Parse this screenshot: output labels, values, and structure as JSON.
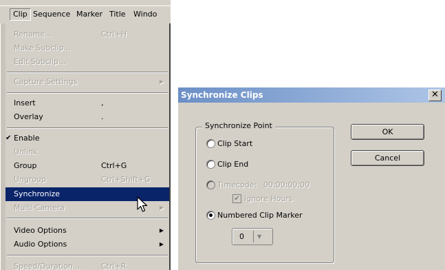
{
  "menubar": {
    "items": [
      "Clip",
      "Sequence",
      "Marker",
      "Title",
      "Windo"
    ]
  },
  "clip_menu": {
    "items": [
      {
        "label": "Rename...",
        "shortcut": "Ctrl+H"
      },
      {
        "label": "Make Subclip..."
      },
      {
        "label": "Edit Subclip..."
      },
      {
        "label": "Capture Settings",
        "arrow": "▶"
      },
      {
        "label": "Insert",
        "shortcut": ","
      },
      {
        "label": "Overlay",
        "shortcut": "."
      },
      {
        "label": "Enable",
        "check": "✔"
      },
      {
        "label": "Unlink"
      },
      {
        "label": "Group",
        "shortcut": "Ctrl+G"
      },
      {
        "label": "Ungroup",
        "shortcut": "Ctrl+Shift+G"
      },
      {
        "label": "Synchronize"
      },
      {
        "label": "Multi-Camera",
        "arrow": "▶"
      },
      {
        "label": "Video Options",
        "arrow": "▶"
      },
      {
        "label": "Audio Options",
        "arrow": "▶"
      },
      {
        "label": "Speed/Duration...",
        "shortcut": "Ctrl+R"
      }
    ]
  },
  "dialog": {
    "title": "Synchronize Clips",
    "close_label": "✕",
    "group_title": "Synchronize Point",
    "options": {
      "clip_start": "Clip Start",
      "clip_end": "Clip End",
      "timecode": "Timecode:",
      "timecode_value": "00;00;00;00",
      "ignore_hours": "Ignore Hours",
      "numbered_marker": "Numbered Clip Marker"
    },
    "marker_value": "0",
    "marker_arrow": "▼",
    "ok_label": "OK",
    "cancel_label": "Cancel"
  },
  "colors": {
    "highlight": "#0a246a",
    "face": "#d4d0c8",
    "title_gradient_start": "#6b8fc6"
  }
}
